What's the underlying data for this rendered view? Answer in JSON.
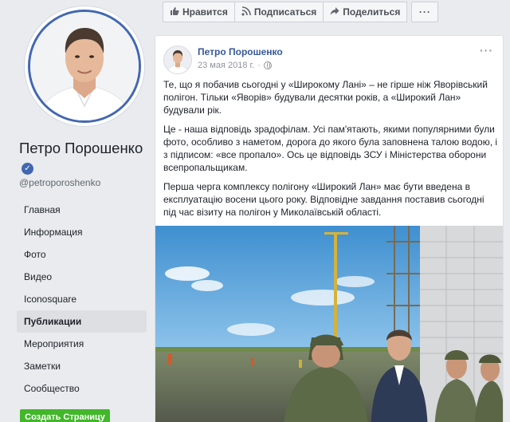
{
  "page": {
    "name": "Петро Порошенко",
    "username": "@petroporoshenko",
    "verified": true
  },
  "nav": [
    {
      "label": "Главная",
      "active": false
    },
    {
      "label": "Информация",
      "active": false
    },
    {
      "label": "Фото",
      "active": false
    },
    {
      "label": "Видео",
      "active": false
    },
    {
      "label": "Iconosquare",
      "active": false
    },
    {
      "label": "Публикации",
      "active": true
    },
    {
      "label": "Мероприятия",
      "active": false
    },
    {
      "label": "Заметки",
      "active": false
    },
    {
      "label": "Сообщество",
      "active": false
    }
  ],
  "create_page_label": "Создать Страницу",
  "actions": {
    "like": "Нравится",
    "follow": "Подписаться",
    "share": "Поделиться",
    "more": "···"
  },
  "post": {
    "author": "Петро Порошенко",
    "date": "23 мая 2018 г.",
    "menu": "···",
    "paragraphs": [
      "Те, що я побачив сьогодні у «Широкому Лані» – не гірше ніж Яворівський полігон. Тільки «Яворів» будували десятки років, а «Широкий Лан» будували рік.",
      "Це - наша відповідь зрадофілам. Усі пам'ятають, якими популярними були фото, особливо з наметом, дорога до якого була заповнена талою водою, і з підписом: «все пропало». Ось це відповідь ЗСУ і Міністерства оборони всепропальщикам.",
      "Перша черга комплексу полігону «Широкий Лан» має бути введена в експлуатацію восени цього року. Відповідне завдання поставив сьогодні під час візиту на полігон у Миколаївській області."
    ]
  },
  "colors": {
    "brand": "#4267b2",
    "link": "#365899",
    "create_button": "#42b72a",
    "background": "#e9ebee"
  }
}
